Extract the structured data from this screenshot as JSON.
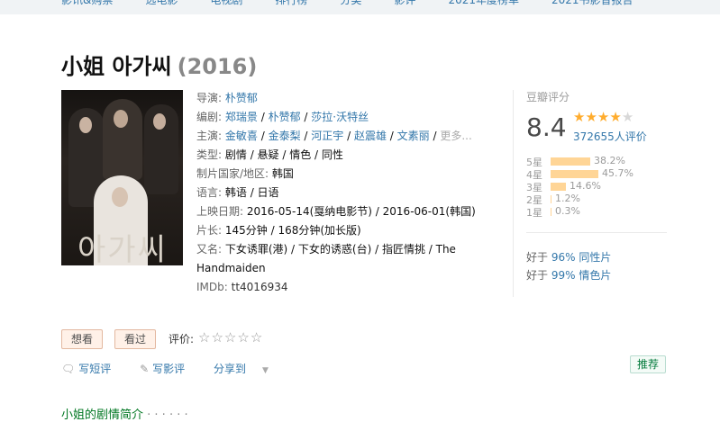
{
  "topnav": [
    "影讯&购票",
    "选电影",
    "电视剧",
    "排行榜",
    "分类",
    "影评",
    "2021年度榜单",
    "2021书影音报告"
  ],
  "movie": {
    "title": "小姐 아가씨",
    "year": "(2016)",
    "poster_text": "아가씨"
  },
  "info": {
    "director_label": "导演:",
    "director": "朴赞郁",
    "writer_label": "编剧:",
    "writers": [
      "郑瑞景",
      "朴赞郁",
      "莎拉·沃特丝"
    ],
    "cast_label": "主演:",
    "cast": [
      "金敏喜",
      "金泰梨",
      "河正宇",
      "赵震雄",
      "文素丽"
    ],
    "cast_more": "更多...",
    "genre_label": "类型:",
    "genre": "剧情 / 悬疑 / 情色 / 同性",
    "country_label": "制片国家/地区:",
    "country": "韩国",
    "language_label": "语言:",
    "language": "韩语 / 日语",
    "release_label": "上映日期:",
    "release": "2016-05-14(戛纳电影节) / 2016-06-01(韩国)",
    "runtime_label": "片长:",
    "runtime": "145分钟 / 168分钟(加长版)",
    "aka_label": "又名:",
    "aka_line1": "下女诱罪(港) / 下女的诱惑(台) / 指匠情挑 / The",
    "aka_line2": "Handmaiden",
    "imdb_label": "IMDb:",
    "imdb": "tt4016934"
  },
  "rating": {
    "label": "豆瓣评分",
    "score": "8.4",
    "stars_filled": 4,
    "stars_total": 5,
    "count": "372655人评价",
    "breakdown": [
      {
        "label": "5星",
        "pct": "38.2%",
        "value": 38.2
      },
      {
        "label": "4星",
        "pct": "45.7%",
        "value": 45.7
      },
      {
        "label": "3星",
        "pct": "14.6%",
        "value": 14.6
      },
      {
        "label": "2星",
        "pct": "1.2%",
        "value": 1.2
      },
      {
        "label": "1星",
        "pct": "0.3%",
        "value": 0.3
      }
    ],
    "better1_prefix": "好于",
    "better1_pct": "96%",
    "better1_genre": "同性片",
    "better2_prefix": "好于",
    "better2_pct": "99%",
    "better2_genre": "情色片"
  },
  "actions": {
    "want_label": "想看",
    "seen_label": "看过",
    "rate_label": "评价:",
    "short_review": "写短评",
    "review": "写影评",
    "share": "分享到",
    "recommend": "推荐"
  },
  "section": {
    "title": "小姐的剧情简介",
    "dots": "· · · · · ·"
  }
}
